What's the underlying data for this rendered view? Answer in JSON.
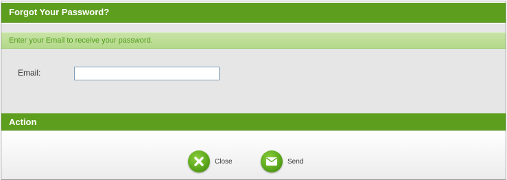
{
  "dialog": {
    "title": "Forgot Your Password?",
    "instruction": "Enter your Email to receive your password.",
    "email_label": "Email:",
    "email_value": "",
    "email_placeholder": ""
  },
  "action": {
    "title": "Action",
    "close_label": "Close",
    "send_label": "Send",
    "close_icon": "close-x-icon",
    "send_icon": "envelope-icon"
  },
  "colors": {
    "header_green": "#5e9e1e",
    "instruction_bg": "#b3d98a",
    "instruction_text": "#4f9a18",
    "body_bg": "#e6e6e6"
  }
}
